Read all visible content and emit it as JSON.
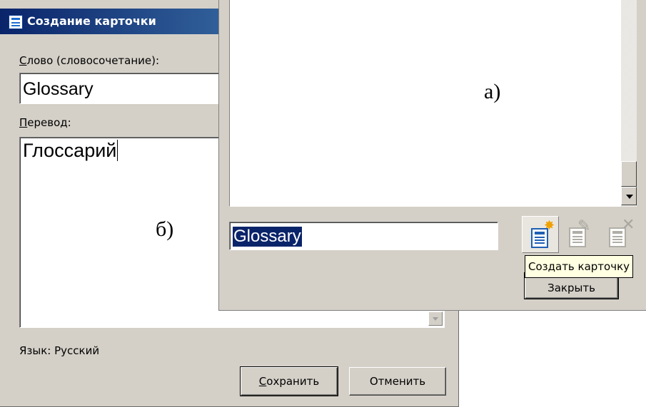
{
  "dialog_b": {
    "title": "Создание карточки",
    "word_label_first": "С",
    "word_label_rest": "лово (словосочетание):",
    "word_value": "Glossary",
    "translation_label_first": "П",
    "translation_label_rest": "еревод:",
    "translation_value": "Глоссарий",
    "language_text": "Язык: Русский",
    "save_first": "С",
    "save_rest": "охранить",
    "cancel_label": "Отменить",
    "figure_label": "б)"
  },
  "window_a": {
    "figure_label": "а)",
    "search_value": "Glossary",
    "tooltip": "Создать карточку",
    "close_label": "Закрыть"
  }
}
